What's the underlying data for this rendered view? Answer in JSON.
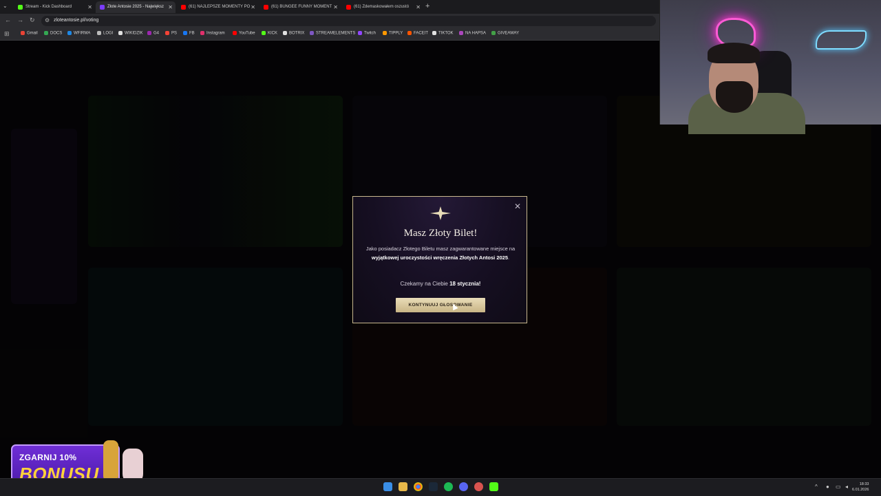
{
  "browser": {
    "tabs": [
      {
        "title": "Stream - Kick Dashboard",
        "color": "#53fc18"
      },
      {
        "title": "Złote Antosie 2025 - Największ",
        "color": "#7b3cff",
        "active": true
      },
      {
        "title": "(61) NAJLEPSZE MOMENTY PO",
        "color": "#ff0000"
      },
      {
        "title": "(61) BUNGEE FUNNY MOMENT",
        "color": "#ff0000"
      },
      {
        "title": "(61) Zdemaskowałem oszustó",
        "color": "#ff0000"
      }
    ],
    "url": "zloteantosie.pl/voting",
    "bookmarks": [
      {
        "label": "Gmail",
        "color": "#ea4335"
      },
      {
        "label": "DOCS",
        "color": "#34a853"
      },
      {
        "label": "WFIRMA",
        "color": "#1e88e5"
      },
      {
        "label": "LOGI",
        "color": "#bbbbbb"
      },
      {
        "label": "WIKIDZIK",
        "color": "#e0e0e0"
      },
      {
        "label": "G4",
        "color": "#9c27b0"
      },
      {
        "label": "PS",
        "color": "#f44336"
      },
      {
        "label": "FB",
        "color": "#1877f2"
      },
      {
        "label": "Instagram",
        "color": "#e1306c"
      },
      {
        "label": "YouTube",
        "color": "#ff0000"
      },
      {
        "label": "KICK",
        "color": "#53fc18"
      },
      {
        "label": "BOTRIX",
        "color": "#e0e0e0"
      },
      {
        "label": "STREAMELEMENTS",
        "color": "#7e57c2"
      },
      {
        "label": "Twitch",
        "color": "#9146ff"
      },
      {
        "label": "TIPPLY",
        "color": "#ff9800"
      },
      {
        "label": "FACEIT",
        "color": "#ff5500"
      },
      {
        "label": "TIKTOK",
        "color": "#e0e0e0"
      },
      {
        "label": "NA HAPSA",
        "color": "#ab47bc"
      },
      {
        "label": "GIVEAWAY",
        "color": "#43a047"
      }
    ]
  },
  "modal": {
    "title": "Masz Złoty Bilet!",
    "body_1": "Jako posiadacz Złotego Biletu masz zagwarantowane miejsce na ",
    "body_bold": "wyjątkowej uroczystości wręczenia Złotych Antosi 2025",
    "body_2": ".",
    "date_prefix": "Czekamy na Ciebie ",
    "date_bold": "18 stycznia!",
    "button": "KONTYNUUJ GŁOSOWANIE",
    "close_icon": "close-icon",
    "accent": "#c9b98f"
  },
  "overlay": {
    "bonus_line1": "ZGARNIJ 10%",
    "bonus_line2": "BONUSU"
  },
  "taskbar": {
    "time": "18:33",
    "date": "6.01.2026"
  }
}
